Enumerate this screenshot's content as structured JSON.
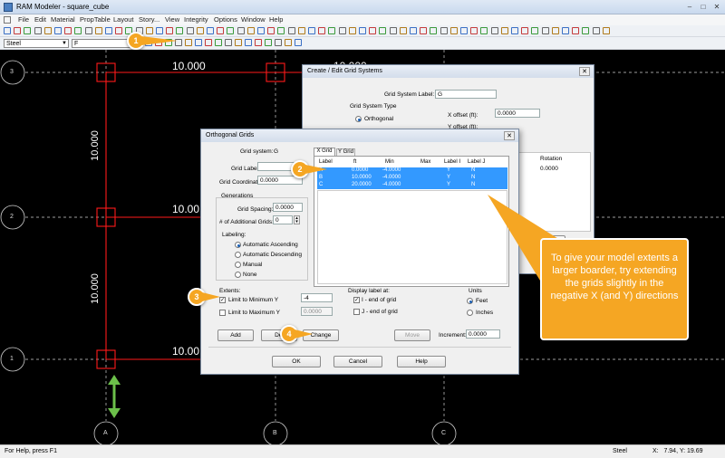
{
  "window": {
    "title": "RAM Modeler - square_cube",
    "min": "–",
    "max": "□",
    "close": "✕"
  },
  "menu": [
    "File",
    "Edit",
    "Material",
    "PropTable",
    "Layout",
    "Story...",
    "View",
    "Integrity",
    "Options",
    "Window",
    "Help"
  ],
  "toolbar2": {
    "material_combo": "Steel",
    "layer_combo": "F"
  },
  "canvas": {
    "dims": [
      "10.000",
      "10.00",
      "10.00",
      "10.000"
    ],
    "vertical_dims": [
      "10.000",
      "10.000"
    ],
    "row_bubbles": [
      "3",
      "2",
      "1"
    ],
    "col_bubbles": [
      "A",
      "B",
      "C"
    ]
  },
  "status": {
    "help": "For Help, press F1",
    "material": "Steel",
    "coords": "X:   7.94, Y: 19.69"
  },
  "grid_systems_dialog": {
    "title": "Create / Edit Grid Systems",
    "label_caption": "Grid System Label:",
    "label_value": "G",
    "type_caption": "Grid System Type",
    "type_option": "Orthogonal",
    "xoffset_caption": "X offset (ft):",
    "xoffset_value": "0.0000",
    "yoffset_caption": "Y offset (ft):",
    "rotation_caption": "Rotation",
    "rotation_value": "0.0000",
    "edit_button_partial": "Ec"
  },
  "orth_dialog": {
    "title": "Orthogonal Grids",
    "grid_system_caption": "Grid system:",
    "grid_system_value": "G",
    "grid_label_caption": "Grid Label:",
    "grid_coord_caption": "Grid Coordinate:",
    "grid_coord_value": "0.0000",
    "generations": "Generations",
    "spacing_caption": "Grid Spacing:",
    "spacing_value": "0.0000",
    "additional_caption": "# of Additional Grids:",
    "additional_value": "0",
    "labeling": "Labeling:",
    "labeling_options": [
      "Automatic Ascending",
      "Automatic Descending",
      "Manual",
      "None"
    ],
    "tabs": [
      "X Grid",
      "Y Grid"
    ],
    "grid_headers": [
      "Label",
      "ft",
      "Min",
      "Max",
      "Label I",
      "Label J"
    ],
    "grid_rows": [
      [
        "A",
        "0.0000",
        "-4.0000",
        "",
        "Y",
        "N"
      ],
      [
        "B",
        "10.0000",
        "-4.0000",
        "",
        "Y",
        "N"
      ],
      [
        "C",
        "20.0000",
        "-4.0000",
        "",
        "Y",
        "N"
      ]
    ],
    "extents": "Extents:",
    "limit_min": "Limit to Minimum Y",
    "limit_min_value": "-4",
    "limit_max": "Limit to Maximum Y",
    "limit_max_value": "0.0000",
    "display_caption": "Display label at:",
    "label_i": "I - end of grid",
    "label_j": "J - end of grid",
    "units": "Units",
    "unit_feet": "Feet",
    "unit_inches": "Inches",
    "add": "Add",
    "delete_partial": "Del",
    "change": "Change",
    "move": "Move",
    "increment_caption": "Increment:",
    "increment_value": "0.0000",
    "ok": "OK",
    "cancel": "Cancel",
    "help": "Help"
  },
  "callouts": {
    "numbers": [
      "1",
      "2",
      "3",
      "4"
    ],
    "tip": "To give your model extents a larger boarder, try extending the grids slightly in the negative X (and Y) directions"
  },
  "colors": {
    "grid": "#ff1a1a",
    "callout": "#f5a623",
    "selection": "#3399ff",
    "arrow": "#6cc04a"
  }
}
